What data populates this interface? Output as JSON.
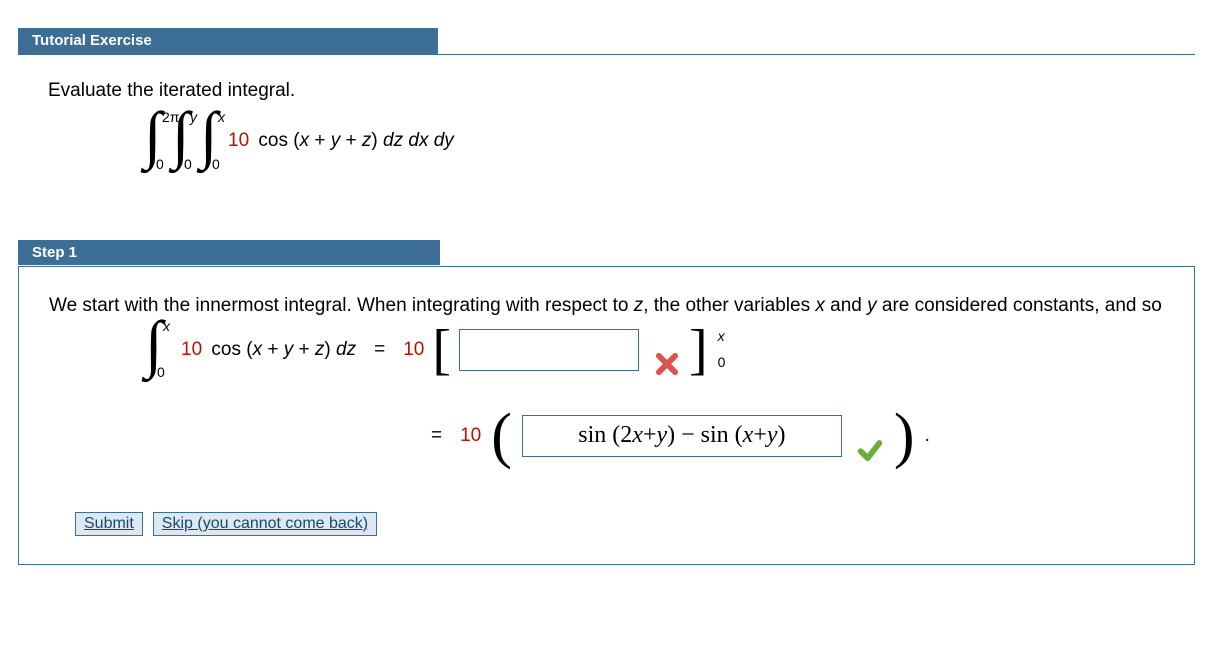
{
  "tutorial": {
    "header": "Tutorial Exercise",
    "prompt": "Evaluate the iterated integral.",
    "outer_upper": "2π",
    "outer_lower": "0",
    "mid_upper": "y",
    "mid_lower": "0",
    "inner_upper": "x",
    "inner_lower": "0",
    "coeff": "10",
    "integrand_plain": "cos (x + y + z) dz dx dy"
  },
  "step": {
    "label": "Step 1",
    "intro": "We start with the innermost integral. When integrating with respect to z, the other variables x and y are considered constants, and so",
    "line1": {
      "int_upper": "x",
      "int_lower": "0",
      "coeff": "10",
      "integrand": "cos (x + y + z) dz",
      "equals": "=",
      "rhs_coeff": "10",
      "eval_upper": "x",
      "eval_lower": "0"
    },
    "line2": {
      "equals": "=",
      "rhs_coeff": "10",
      "answer": "sin (2x + y) − sin (x + y)",
      "tail": "."
    }
  },
  "buttons": {
    "submit": "Submit",
    "skip": "Skip (you cannot come back)"
  }
}
